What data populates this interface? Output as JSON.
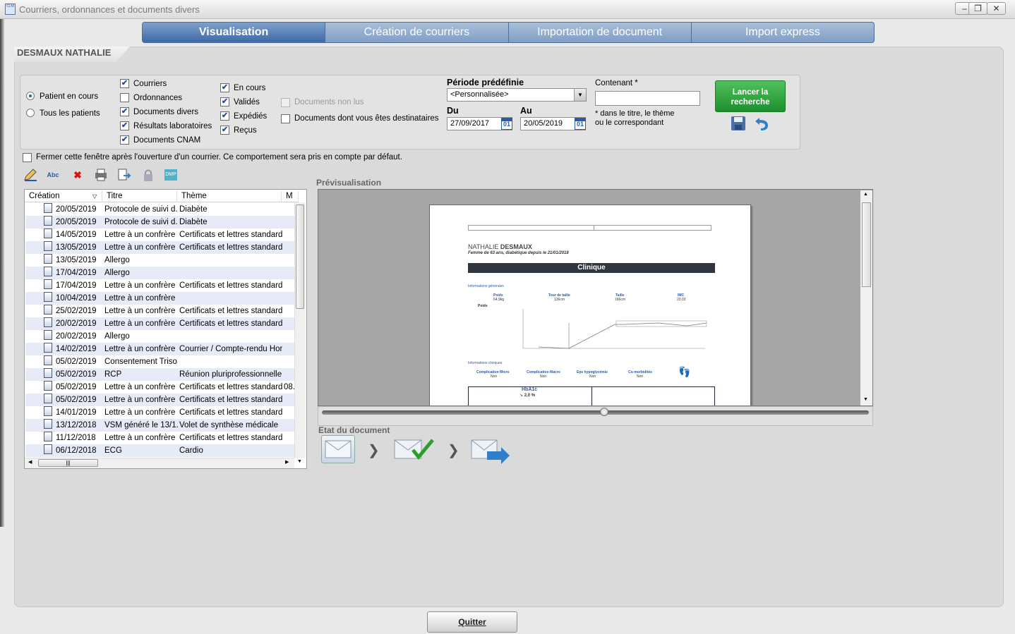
{
  "window": {
    "title": "Courriers, ordonnances et documents divers",
    "icon_text": "CLM"
  },
  "tabs": [
    {
      "label": "Visualisation"
    },
    {
      "label": "Création de courriers"
    },
    {
      "label": "Importation de document"
    },
    {
      "label": "Import express"
    }
  ],
  "patient": {
    "name": "DESMAUX NATHALIE"
  },
  "filters": {
    "patient_scope": [
      {
        "label": "Patient en cours",
        "selected": true
      },
      {
        "label": "Tous les patients",
        "selected": false
      }
    ],
    "doc_types": [
      {
        "label": "Courriers",
        "checked": true
      },
      {
        "label": "Ordonnances",
        "checked": false
      },
      {
        "label": "Documents divers",
        "checked": true
      },
      {
        "label": "Résultats laboratoires",
        "checked": true
      },
      {
        "label": "Documents CNAM",
        "checked": true
      }
    ],
    "statuses": [
      {
        "label": "En cours",
        "checked": true
      },
      {
        "label": "Validés",
        "checked": true
      },
      {
        "label": "Expédiés",
        "checked": true
      },
      {
        "label": "Reçus",
        "checked": true
      }
    ],
    "unread_label": "Documents non lus",
    "recipient_label": "Documents dont vous êtes destinataires",
    "period_title": "Période prédéfinie",
    "period_value": "<Personnalisée>",
    "from_label": "Du",
    "from_value": "27/09/2017",
    "to_label": "Au",
    "to_value": "20/05/2019",
    "calendar_text": "01",
    "contains_label": "Contenant *",
    "contains_value": "",
    "contains_note_1": "* dans le titre, le thème",
    "contains_note_2": "ou le correspondant",
    "search_button": "Lancer la recherche"
  },
  "close_after_open_label": "Fermer cette fenêtre après l'ouverture d'un courrier. Ce comportement sera pris en compte par défaut.",
  "toolbar": {
    "spell_text": "Abc",
    "dmp_text": "DMP"
  },
  "list": {
    "columns": [
      "Création",
      "Titre",
      "Thème",
      "M"
    ],
    "rows": [
      {
        "date": "20/05/2019",
        "title": "Protocole de suivi d...",
        "theme": "Diabète",
        "m": ""
      },
      {
        "date": "20/05/2019",
        "title": "Protocole de suivi d...",
        "theme": "Diabète",
        "m": ""
      },
      {
        "date": "14/05/2019",
        "title": "Lettre à un confrère ...",
        "theme": "Certificats et lettres standard",
        "m": ""
      },
      {
        "date": "13/05/2019",
        "title": "Lettre à un confrère ...",
        "theme": "Certificats et lettres standard",
        "m": ""
      },
      {
        "date": "13/05/2019",
        "title": "Allergo",
        "theme": "",
        "m": ""
      },
      {
        "date": "17/04/2019",
        "title": "Allergo",
        "theme": "",
        "m": ""
      },
      {
        "date": "17/04/2019",
        "title": "Lettre à un confrère ...",
        "theme": "Certificats et lettres standard",
        "m": ""
      },
      {
        "date": "10/04/2019",
        "title": "Lettre à un confrère ...",
        "theme": "",
        "m": ""
      },
      {
        "date": "25/02/2019",
        "title": "Lettre à un confrère ...",
        "theme": "Certificats et lettres standard",
        "m": ""
      },
      {
        "date": "20/02/2019",
        "title": "Lettre à un confrère ...",
        "theme": "Certificats et lettres standard",
        "m": ""
      },
      {
        "date": "20/02/2019",
        "title": "Allergo",
        "theme": "",
        "m": ""
      },
      {
        "date": "14/02/2019",
        "title": "Lettre à un confrère ...",
        "theme": "Courrier / Compte-rendu Hom...",
        "m": ""
      },
      {
        "date": "05/02/2019",
        "title": "Consentement Triso...",
        "theme": "",
        "m": ""
      },
      {
        "date": "05/02/2019",
        "title": "RCP",
        "theme": "Réunion pluriprofessionnelle",
        "m": ""
      },
      {
        "date": "05/02/2019",
        "title": "Lettre à un confrère ...",
        "theme": "Certificats et lettres standard",
        "m": "08."
      },
      {
        "date": "05/02/2019",
        "title": "Lettre à un confrère ...",
        "theme": "Certificats et lettres standard",
        "m": ""
      },
      {
        "date": "14/01/2019",
        "title": "Lettre à un confrère ...",
        "theme": "Certificats et lettres standard",
        "m": ""
      },
      {
        "date": "13/12/2018",
        "title": "VSM généré le 13/1...",
        "theme": "Volet de synthèse médicale",
        "m": ""
      },
      {
        "date": "11/12/2018",
        "title": "Lettre à un confrère ...",
        "theme": "Certificats et lettres standard",
        "m": ""
      },
      {
        "date": "06/12/2018",
        "title": "ECG",
        "theme": "Cardio",
        "m": ""
      }
    ]
  },
  "preview": {
    "label": "Prévisualisation",
    "patient_first": "NATHALIE",
    "patient_last": "DESMAUX",
    "subtitle": "Femme de 63 ans, diabétique depuis le 21/01/2018",
    "section": "Clinique",
    "general_info": "Informations générales",
    "metrics": [
      {
        "name": "Poids",
        "value": "64,9kg"
      },
      {
        "name": "Tour de taille",
        "value": "136cm"
      },
      {
        "name": "Taille",
        "value": "166cm"
      },
      {
        "name": "IMC",
        "value": "23,03"
      }
    ],
    "chart_label": "Poids",
    "clinical_info": "Informations cliniques",
    "clinical": [
      {
        "name": "Complication Micro",
        "value": "Non"
      },
      {
        "name": "Complication Macro",
        "value": "Non"
      },
      {
        "name": "Eps hypoglycémie",
        "value": "Non"
      },
      {
        "name": "Co-morbidités",
        "value": "Non"
      }
    ],
    "hba1c_label": "HbA1c",
    "hba1c_value": "2,0 %"
  },
  "document_state_label": "Etat du document",
  "quit_button": "Quitter",
  "colors": {
    "accent": "#3f6aa6",
    "search_green": "#1e8f2e"
  }
}
